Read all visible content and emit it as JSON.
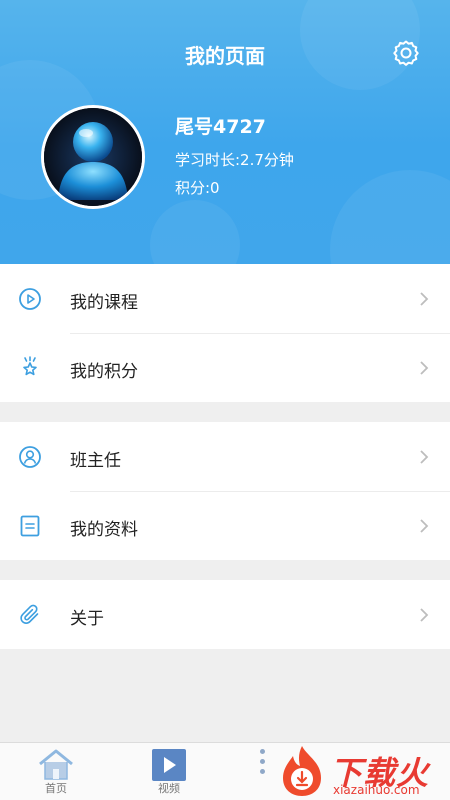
{
  "header": {
    "title": "我的页面",
    "username": "尾号4727",
    "study_time": "学习时长:2.7分钟",
    "points": "积分:0"
  },
  "menu_groups": [
    {
      "items": [
        {
          "label": "我的课程",
          "icon": "play-circle-icon"
        },
        {
          "label": "我的积分",
          "icon": "star-award-icon"
        }
      ]
    },
    {
      "items": [
        {
          "label": "班主任",
          "icon": "person-circle-icon"
        },
        {
          "label": "我的资料",
          "icon": "document-icon"
        }
      ]
    },
    {
      "items": [
        {
          "label": "关于",
          "icon": "paperclip-icon"
        }
      ]
    }
  ],
  "tabbar": {
    "tabs": [
      {
        "label": "首页",
        "icon": "home-icon"
      },
      {
        "label": "视频",
        "icon": "video-play-icon"
      }
    ]
  },
  "watermark": {
    "text": "下载火",
    "url_text": "xiazaihuo.com"
  },
  "colors": {
    "header_blue": "#40a6eb",
    "icon_blue": "#3d9fe0",
    "watermark_red": "#e83a32"
  }
}
